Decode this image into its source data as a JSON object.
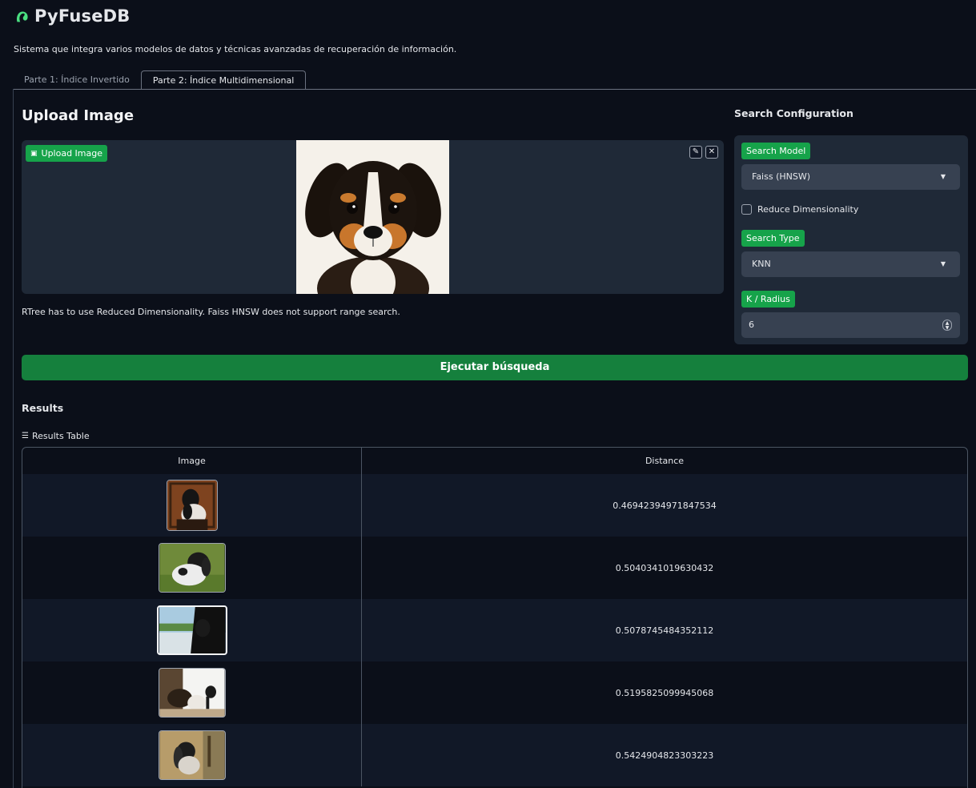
{
  "app": {
    "title": "PyFuseDB",
    "subtitle": "Sistema que integra varios modelos de datos y técnicas avanzadas de recuperación de información."
  },
  "tabs": [
    {
      "label": "Parte 1: Índice Invertido",
      "active": false
    },
    {
      "label": "Parte 2: Índice Multidimensional",
      "active": true
    }
  ],
  "upload": {
    "heading": "Upload Image",
    "label": "Upload Image",
    "hint": "RTree has to use Reduced Dimensionality. Faiss HNSW does not support range search."
  },
  "config": {
    "heading": "Search Configuration",
    "search_model_label": "Search Model",
    "search_model_value": "Faiss (HNSW)",
    "reduce_label": "Reduce Dimensionality",
    "reduce_checked": false,
    "search_type_label": "Search Type",
    "search_type_value": "KNN",
    "k_label": "K / Radius",
    "k_value": "6"
  },
  "run_button": "Ejecutar búsqueda",
  "results": {
    "heading": "Results",
    "table_label": "Results Table",
    "columns": [
      "Image",
      "Distance"
    ],
    "rows": [
      {
        "distance": "0.46942394971847534"
      },
      {
        "distance": "0.5040341019630432"
      },
      {
        "distance": "0.5078745484352112"
      },
      {
        "distance": "0.5195825099945068"
      },
      {
        "distance": "0.5424904823303223"
      }
    ]
  },
  "colors": {
    "background": "#0b0f19",
    "panel": "#1f2937",
    "accent": "#16a34a",
    "brand": "#4ade80"
  },
  "icons": [
    "logo-icon",
    "image-icon",
    "edit-icon",
    "close-icon",
    "chevron-down-icon",
    "list-icon",
    "spinner-icon"
  ]
}
